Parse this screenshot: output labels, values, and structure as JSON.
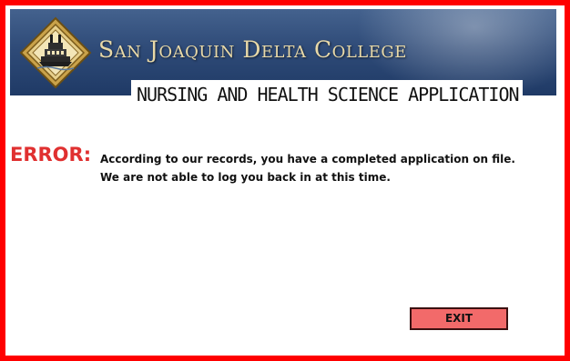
{
  "header": {
    "college_name": "San Joaquin Delta College",
    "application_title": "NURSING AND HEALTH SCIENCE APPLICATION",
    "logo_icon": "college-seal-icon"
  },
  "error": {
    "label": "ERROR:",
    "line1": "According to our records, you have a completed application on file.",
    "line2": "We are not able to log you back in at this time."
  },
  "actions": {
    "exit_label": "EXIT"
  },
  "colors": {
    "frame_border": "#ff0000",
    "banner": "#2f4b78",
    "college_name_text": "#e8d9a8",
    "error_label": "#e03030",
    "exit_button": "#f26a6a"
  }
}
